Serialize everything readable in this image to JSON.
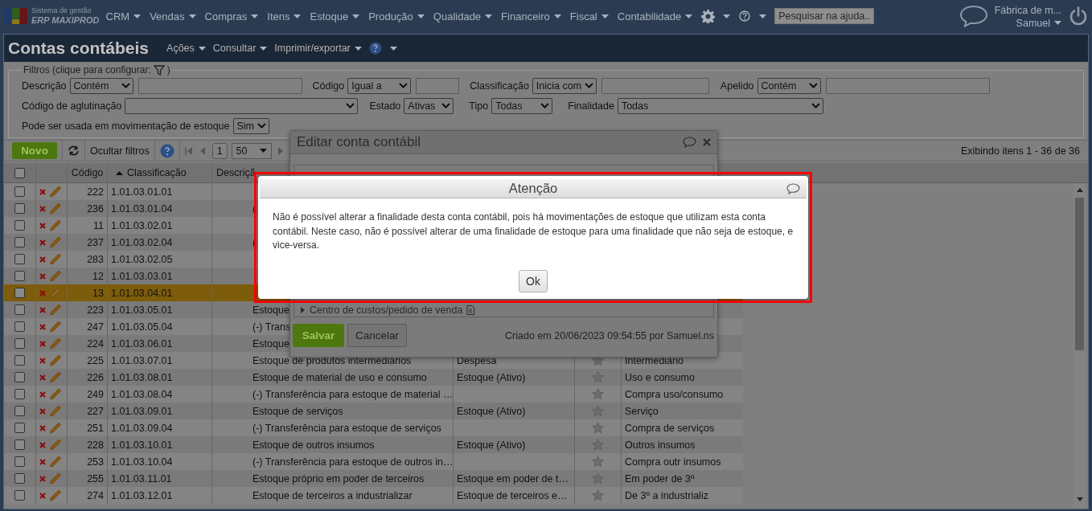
{
  "nav": {
    "brand": [
      "Sistema de gestão",
      "ERP MAXIPROD"
    ],
    "menus": [
      "CRM",
      "Vendas",
      "Compras",
      "Itens",
      "Estoque",
      "Produção",
      "Qualidade",
      "Financeiro",
      "Fiscal",
      "Contabilidade"
    ],
    "search": {
      "placeholder": "Pesquisar na ajuda..."
    },
    "company": "Fábrica de m...",
    "user": "Samuel"
  },
  "page": {
    "title": "Contas contábeis",
    "menus": [
      "Ações",
      "Consultar",
      "Imprimir/exportar"
    ]
  },
  "filters": {
    "legend": "Filtros (clique para configurar:",
    "legend_close": ")",
    "rows": [
      [
        {
          "kind": "text",
          "label": "Descrição",
          "operator": "Contém"
        },
        {
          "kind": "text",
          "label": "Código",
          "operator": "Igual a"
        },
        {
          "kind": "text",
          "label": "Classificação",
          "operator": "Inicia com"
        },
        {
          "kind": "text",
          "label": "Apelido",
          "operator": "Contém"
        }
      ],
      [
        {
          "kind": "select",
          "label": "Código de aglutinação"
        },
        {
          "kind": "select",
          "label": "Estado",
          "value": "Ativas"
        },
        {
          "kind": "select",
          "label": "Tipo",
          "value": "Todas"
        },
        {
          "kind": "select",
          "label": "Finalidade",
          "value": "Todas"
        }
      ],
      [
        {
          "kind": "select",
          "label": "Pode ser usada em movimentação de estoque",
          "value": "Sim"
        }
      ]
    ]
  },
  "toolbar": {
    "new_button": "Novo",
    "hide_filters": "Ocultar filtros",
    "page": "1",
    "page_size": "50",
    "summary": "Exibindo itens 1 - 36 de 36"
  },
  "grid": {
    "select_all_checked": false,
    "columns": [
      {
        "label": "Código",
        "sorted_ascending": false
      },
      {
        "label": "Classificação",
        "sorted_ascending": true
      },
      {
        "label": "Descriçã",
        "sorted_ascending": false
      }
    ],
    "rows": [
      {
        "code": "222",
        "class": "1.01.03.01.01",
        "selected": false
      },
      {
        "code": "236",
        "class": "1.01.03.01.04",
        "desc": "(",
        "selected": false
      },
      {
        "code": "11",
        "class": "1.01.03.02.01",
        "selected": false
      },
      {
        "code": "237",
        "class": "1.01.03.02.04",
        "desc": "(",
        "selected": false
      },
      {
        "code": "283",
        "class": "1.01.03.02.05",
        "selected": false
      },
      {
        "code": "12",
        "class": "1.01.03.03.01",
        "selected": false
      },
      {
        "code": "13",
        "class": "1.01.03.04.01",
        "selected": true
      },
      {
        "code": "223",
        "class": "1.01.03.05.01",
        "desc": "Estoque",
        "selected": false
      },
      {
        "code": "247",
        "class": "1.01.03.05.04",
        "desc": "(-) Trans",
        "selected": false
      },
      {
        "code": "224",
        "class": "1.01.03.06.01",
        "desc": "Estoque",
        "selected": false
      },
      {
        "code": "225",
        "class": "1.01.03.07.01",
        "desc": "Estoque de produtos intermediários",
        "type": "Despesa",
        "purpose": "Intermediário",
        "selected": false
      },
      {
        "code": "226",
        "class": "1.01.03.08.01",
        "desc": "Estoque de material de uso e consumo",
        "type": "Estoque (Ativo)",
        "purpose": "Uso e consumo",
        "selected": false
      },
      {
        "code": "249",
        "class": "1.01.03.08.04",
        "desc": "(-) Transferência para estoque de material …",
        "purpose": "Compra uso/consumo",
        "selected": false
      },
      {
        "code": "227",
        "class": "1.01.03.09.01",
        "desc": "Estoque de serviços",
        "type": "Estoque (Ativo)",
        "purpose": "Serviço",
        "selected": false
      },
      {
        "code": "251",
        "class": "1.01.03.09.04",
        "desc": "(-) Transferência para estoque de serviços",
        "purpose": "Compra de serviços",
        "selected": false
      },
      {
        "code": "228",
        "class": "1.01.03.10.01",
        "desc": "Estoque de outros insumos",
        "type": "Estoque (Ativo)",
        "purpose": "Outros insumos",
        "selected": false
      },
      {
        "code": "253",
        "class": "1.01.03.10.04",
        "desc": "(-) Transferência para estoque de outros in…",
        "purpose": "Compra outr insumos",
        "selected": false
      },
      {
        "code": "255",
        "class": "1.01.03.11.01",
        "desc": "Estoque próprio em poder de terceiros",
        "type": "Estoque em poder de t…",
        "purpose": "Em poder de 3º",
        "selected": false
      },
      {
        "code": "274",
        "class": "1.01.03.12.01",
        "desc": "Estoque de terceiros a industrializar",
        "type": "Estoque de terceiros e…",
        "purpose": "De 3º a industrializ",
        "selected": false
      }
    ]
  },
  "edit_dialog": {
    "title": "Editar conta contábil",
    "section": "Centro de custos/pedido de venda",
    "save": "Salvar",
    "cancel": "Cancelar",
    "created": "Criado em 20/06/2023 09:54:55 por Samuel.ns"
  },
  "alert": {
    "title": "Atenção",
    "message": "Não é possível alterar a finalidade desta conta contábil, pois há movimentações de estoque que utilizam esta conta contábil. Neste caso, não é possível alterar de uma finalidade de estoque para uma finalidade que não seja de estoque, e vice-versa.",
    "ok": "Ok"
  }
}
